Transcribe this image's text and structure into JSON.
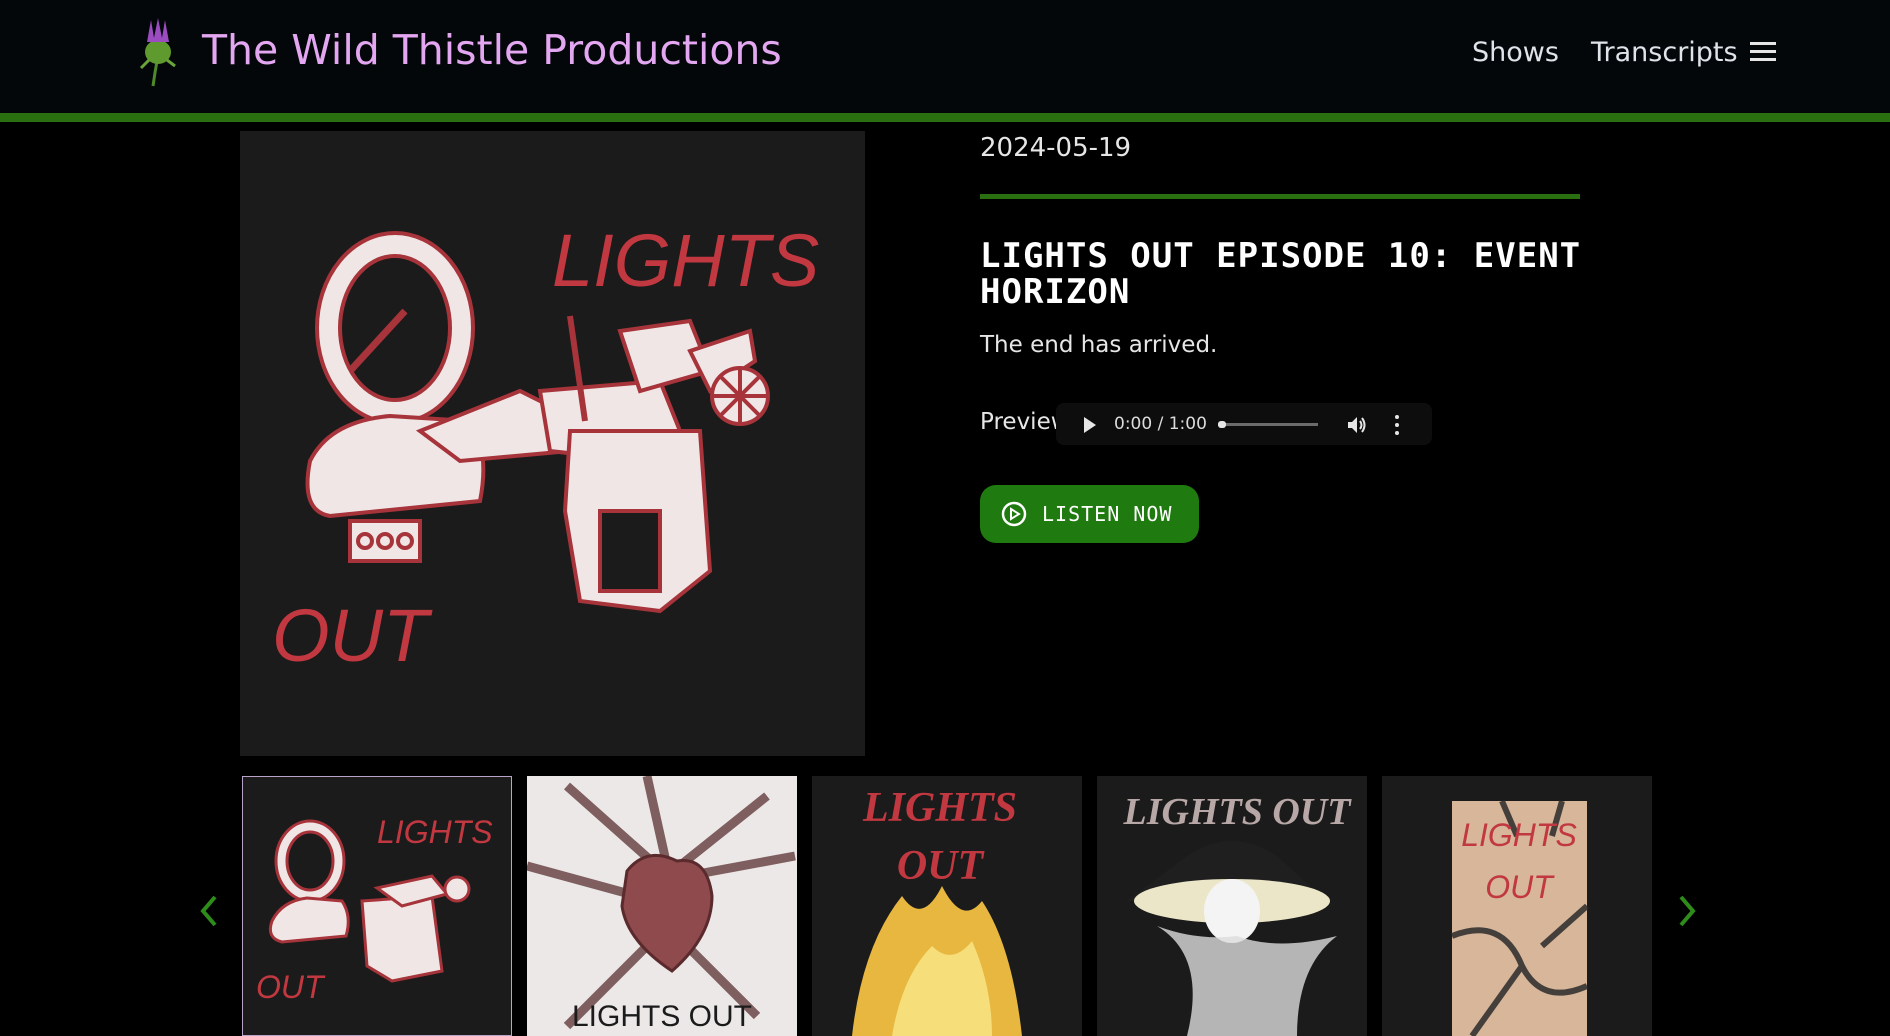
{
  "header": {
    "brand": "The Wild Thistle Productions",
    "nav": [
      "Shows",
      "Transcripts"
    ],
    "accent_color": "#2a6f10",
    "brand_color": "#e3a6f0",
    "icons": {
      "logo": "thistle-logo-icon",
      "menu": "hamburger-menu-icon"
    }
  },
  "episode": {
    "art": {
      "text_top": "LIGHTS",
      "text_bottom": "OUT"
    },
    "date": "2024-05-19",
    "title": "LIGHTS OUT EPISODE 10: EVENT HORIZON",
    "description": "The end has arrived.",
    "preview_label": "Preview:",
    "player": {
      "time": "0:00 / 1:00",
      "progress": 0.0
    },
    "listen_label": "LISTEN NOW",
    "button_color": "#1f7a0f"
  },
  "carousel": {
    "thumbs": [
      {
        "line1": "LIGHTS",
        "line2": "OUT",
        "active": true
      },
      {
        "line1": "LIGHTS OUT"
      },
      {
        "line1": "LIGHTS",
        "line2": "OUT"
      },
      {
        "line1": "LIGHTS OUT"
      },
      {
        "line1": "LIGHTS",
        "line2": "OUT"
      }
    ],
    "prev_icon": "chevron-left-icon",
    "next_icon": "chevron-right-icon"
  }
}
